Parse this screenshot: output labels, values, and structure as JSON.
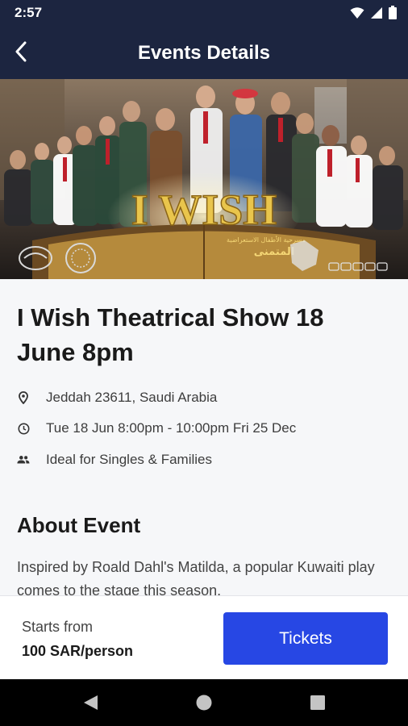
{
  "status_bar": {
    "time": "2:57",
    "icons": [
      "wifi-icon",
      "signal-icon",
      "battery-icon"
    ]
  },
  "app_bar": {
    "title": "Events Details",
    "back_icon": "chevron-left-icon"
  },
  "hero": {
    "logo_text": "I WISH",
    "arabic_caption": "مسرحية الأطفال الاستعراضية",
    "arabic_title": "المتمنى"
  },
  "event": {
    "title": "I Wish Theatrical Show 18 June 8pm",
    "location": "Jeddah 23611, Saudi Arabia",
    "datetime": "Tue 18 Jun 8:00pm - 10:00pm Fri 25 Dec",
    "audience": "Ideal for Singles & Families"
  },
  "about": {
    "heading": "About Event",
    "text": "Inspired by Roald Dahl's Matilda, a popular Kuwaiti play comes to the stage this season."
  },
  "footer": {
    "starts_from_label": "Starts from",
    "price": "100 SAR/person",
    "tickets_label": "Tickets"
  },
  "colors": {
    "header_bg": "#1c2540",
    "button_bg": "#2747e4",
    "page_bg": "#f6f7f9"
  }
}
